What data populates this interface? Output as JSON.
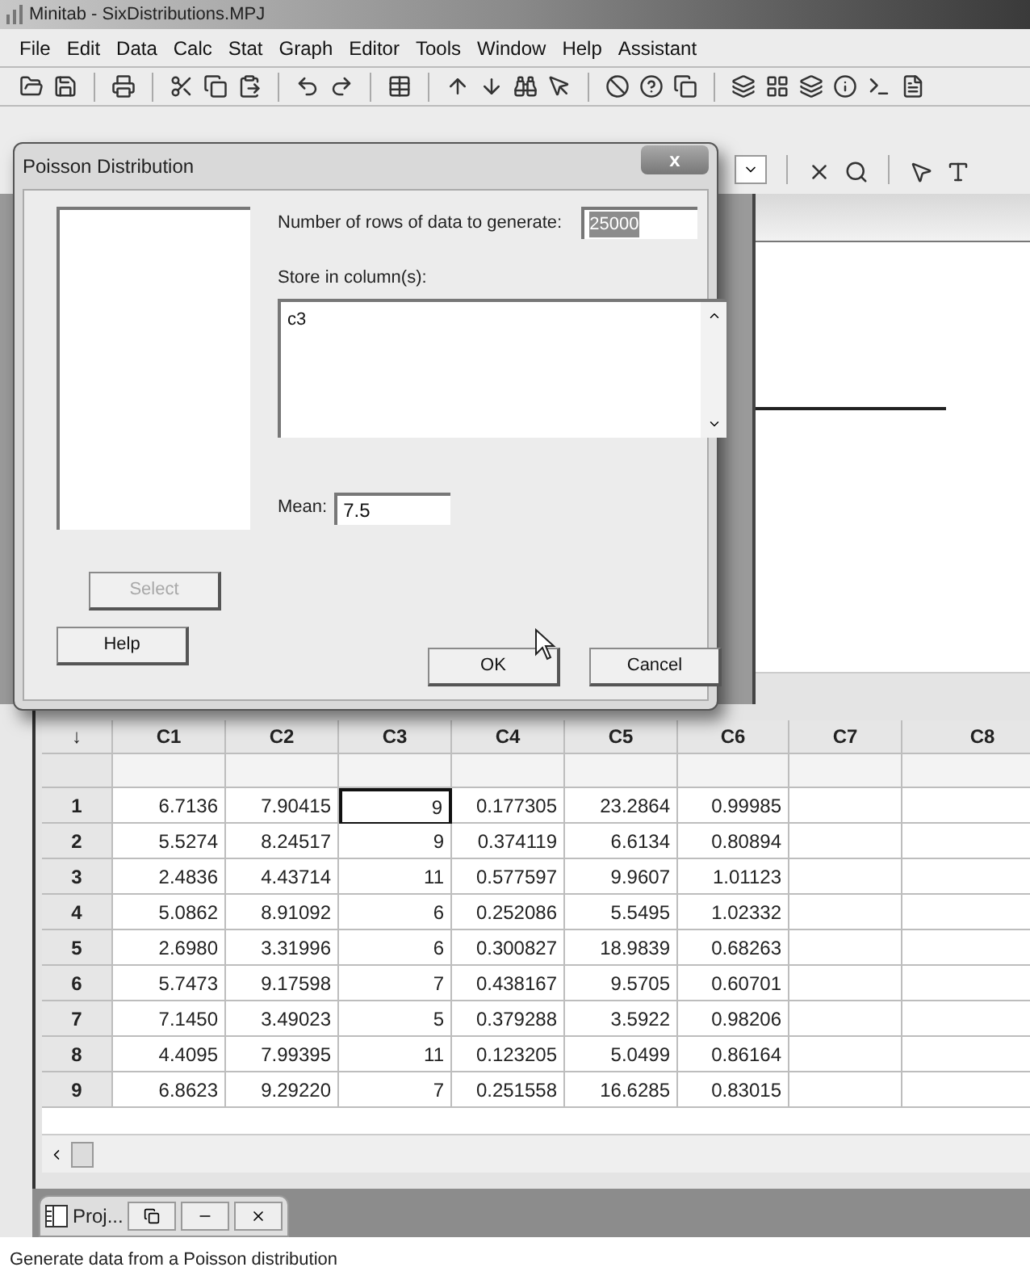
{
  "app": {
    "title": "Minitab - SixDistributions.MPJ"
  },
  "menu": [
    "File",
    "Edit",
    "Data",
    "Calc",
    "Stat",
    "Graph",
    "Editor",
    "Tools",
    "Window",
    "Help",
    "Assistant"
  ],
  "dialog": {
    "title": "Poisson Distribution",
    "close": "x",
    "rows_label": "Number of rows of data to generate:",
    "rows_value": "25000",
    "rows_value_selected": true,
    "store_label": "Store in column(s):",
    "store_value": "c3",
    "mean_label": "Mean:",
    "mean_value": "7.5",
    "buttons": [
      {
        "label": "Select",
        "disabled": true
      },
      {
        "label": "Help",
        "disabled": false
      },
      {
        "label": "OK",
        "disabled": false
      },
      {
        "label": "Cancel",
        "disabled": false
      }
    ]
  },
  "worksheet": {
    "corner": "↓",
    "columns": [
      "C1",
      "C2",
      "C3",
      "C4",
      "C5",
      "C6",
      "C7",
      "C8"
    ],
    "rows": [
      {
        "label": "1",
        "cells": [
          {
            "text": "6.7136",
            "selected": false
          },
          {
            "text": "7.90415",
            "selected": false
          },
          {
            "text": "9",
            "selected": true
          },
          {
            "text": "0.177305",
            "selected": false
          },
          {
            "text": "23.2864",
            "selected": false
          },
          {
            "text": "0.99985",
            "selected": false
          }
        ]
      },
      {
        "label": "2",
        "cells": [
          {
            "text": "5.5274",
            "selected": false
          },
          {
            "text": "8.24517",
            "selected": false
          },
          {
            "text": "9",
            "selected": false
          },
          {
            "text": "0.374119",
            "selected": false
          },
          {
            "text": "6.6134",
            "selected": false
          },
          {
            "text": "0.80894",
            "selected": false
          }
        ]
      },
      {
        "label": "3",
        "cells": [
          {
            "text": "2.4836",
            "selected": false
          },
          {
            "text": "4.43714",
            "selected": false
          },
          {
            "text": "11",
            "selected": false
          },
          {
            "text": "0.577597",
            "selected": false
          },
          {
            "text": "9.9607",
            "selected": false
          },
          {
            "text": "1.01123",
            "selected": false
          }
        ]
      },
      {
        "label": "4",
        "cells": [
          {
            "text": "5.0862",
            "selected": false
          },
          {
            "text": "8.91092",
            "selected": false
          },
          {
            "text": "6",
            "selected": false
          },
          {
            "text": "0.252086",
            "selected": false
          },
          {
            "text": "5.5495",
            "selected": false
          },
          {
            "text": "1.02332",
            "selected": false
          }
        ]
      },
      {
        "label": "5",
        "cells": [
          {
            "text": "2.6980",
            "selected": false
          },
          {
            "text": "3.31996",
            "selected": false
          },
          {
            "text": "6",
            "selected": false
          },
          {
            "text": "0.300827",
            "selected": false
          },
          {
            "text": "18.9839",
            "selected": false
          },
          {
            "text": "0.68263",
            "selected": false
          }
        ]
      },
      {
        "label": "6",
        "cells": [
          {
            "text": "5.7473",
            "selected": false
          },
          {
            "text": "9.17598",
            "selected": false
          },
          {
            "text": "7",
            "selected": false
          },
          {
            "text": "0.438167",
            "selected": false
          },
          {
            "text": "9.5705",
            "selected": false
          },
          {
            "text": "0.60701",
            "selected": false
          }
        ]
      },
      {
        "label": "7",
        "cells": [
          {
            "text": "7.1450",
            "selected": false
          },
          {
            "text": "3.49023",
            "selected": false
          },
          {
            "text": "5",
            "selected": false
          },
          {
            "text": "0.379288",
            "selected": false
          },
          {
            "text": "3.5922",
            "selected": false
          },
          {
            "text": "0.98206",
            "selected": false
          }
        ]
      },
      {
        "label": "8",
        "cells": [
          {
            "text": "4.4095",
            "selected": false
          },
          {
            "text": "7.99395",
            "selected": false
          },
          {
            "text": "11",
            "selected": false
          },
          {
            "text": "0.123205",
            "selected": false
          },
          {
            "text": "5.0499",
            "selected": false
          },
          {
            "text": "0.86164",
            "selected": false
          }
        ]
      },
      {
        "label": "9",
        "cells": [
          {
            "text": "6.8623",
            "selected": false
          },
          {
            "text": "9.29220",
            "selected": false
          },
          {
            "text": "7",
            "selected": false
          },
          {
            "text": "0.251558",
            "selected": false
          },
          {
            "text": "16.6285",
            "selected": false
          },
          {
            "text": "0.83015",
            "selected": false
          }
        ]
      }
    ]
  },
  "minimized": {
    "label": "Proj..."
  },
  "status_bar": "Generate data from a Poisson distribution"
}
